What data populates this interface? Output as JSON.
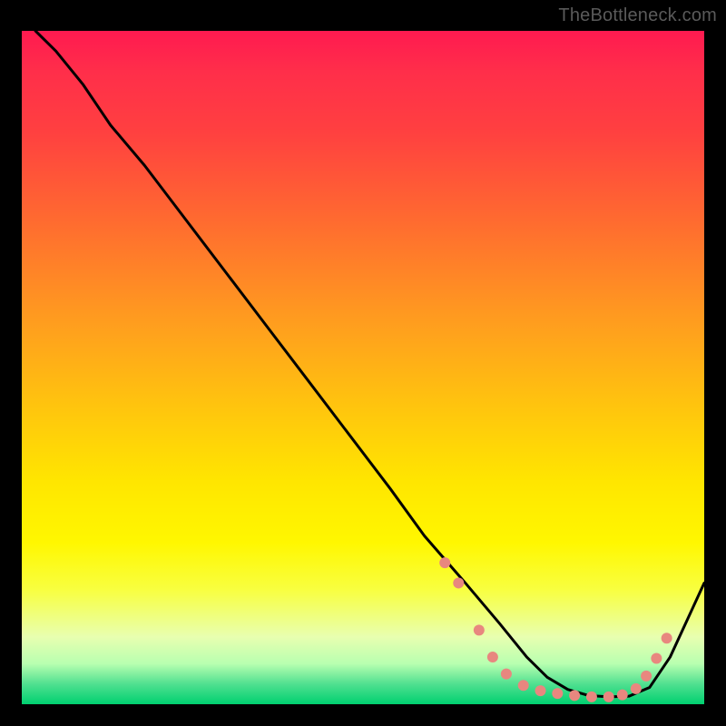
{
  "watermark": "TheBottleneck.com",
  "chart_data": {
    "type": "line",
    "title": "",
    "xlabel": "",
    "ylabel": "",
    "xlim": [
      0,
      100
    ],
    "ylim": [
      0,
      100
    ],
    "background_gradient": {
      "top": "#ff1a50",
      "bottom": "#00d070"
    },
    "series": [
      {
        "name": "bottleneck-curve",
        "color": "#000000",
        "x": [
          2,
          5,
          9,
          13,
          18,
          24,
          30,
          36,
          42,
          48,
          54,
          59,
          65,
          70,
          74,
          77,
          80,
          83,
          86,
          89,
          92,
          95,
          100
        ],
        "y": [
          100,
          97,
          92,
          86,
          80,
          72,
          64,
          56,
          48,
          40,
          32,
          25,
          18,
          12,
          7,
          4,
          2.2,
          1.3,
          1.1,
          1.2,
          2.5,
          7,
          18
        ]
      }
    ],
    "markers": {
      "name": "marker-dots",
      "color": "#e8877f",
      "points": [
        {
          "x": 62,
          "y": 21
        },
        {
          "x": 64,
          "y": 18
        },
        {
          "x": 67,
          "y": 11
        },
        {
          "x": 69,
          "y": 7
        },
        {
          "x": 71,
          "y": 4.5
        },
        {
          "x": 73.5,
          "y": 2.8
        },
        {
          "x": 76,
          "y": 2.0
        },
        {
          "x": 78.5,
          "y": 1.6
        },
        {
          "x": 81,
          "y": 1.3
        },
        {
          "x": 83.5,
          "y": 1.1
        },
        {
          "x": 86,
          "y": 1.1
        },
        {
          "x": 88,
          "y": 1.4
        },
        {
          "x": 90,
          "y": 2.3
        },
        {
          "x": 91.5,
          "y": 4.2
        },
        {
          "x": 93,
          "y": 6.8
        },
        {
          "x": 94.5,
          "y": 9.8
        }
      ]
    }
  }
}
